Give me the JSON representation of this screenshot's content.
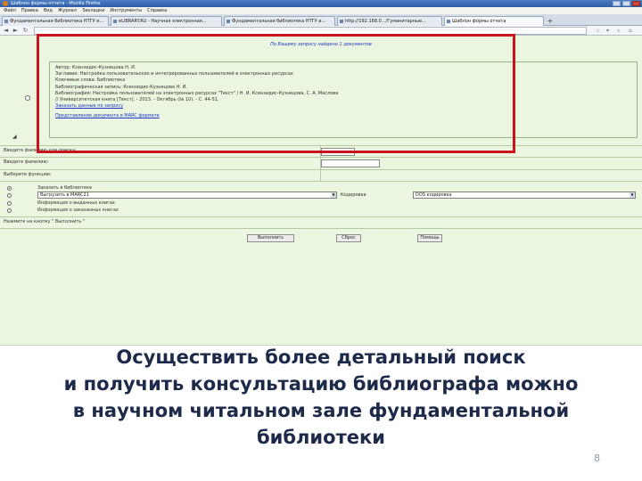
{
  "window": {
    "title": "Шаблон формы отчета - Mozilla Firefox",
    "controls": [
      "minimize",
      "maximize",
      "close"
    ]
  },
  "menu": [
    "Файл",
    "Правка",
    "Вид",
    "Журнал",
    "Закладки",
    "Инструменты",
    "Справка"
  ],
  "tabs": [
    {
      "label": "Фундаментальная библиотека НТГУ и...",
      "active": false
    },
    {
      "label": "eLIBRARY.RU - Научная электронная...",
      "active": false
    },
    {
      "label": "Фундаментальная библиотека НТГУ и...",
      "active": false
    },
    {
      "label": "http://192.168.0.../Гуманитарные...",
      "active": false
    },
    {
      "label": "Шаблон формы отчета",
      "active": true
    }
  ],
  "nav": {
    "back_icon": "back-icon",
    "forward_icon": "forward-icon",
    "home_icon": "home-icon",
    "url": ""
  },
  "results": {
    "found_message": "По Вашему запросу найдено 1 документов",
    "record_lines": [
      "Автор: Ксензидис-Кузнецова Н. И.",
      "Заглавие: Настройка пользовательских и интегрированных пользователей в электронных ресурсах",
      "Ключевые слова: Библиотека",
      "Библиографическая запись: Ксензидис-Кузнецова Н. И.",
      "Библиография: Настройка пользователей на электронных ресурсах \"Текст\" / Н. И. Ксензидис-Кузнецова, С. А. Маслова",
      "// Университетская книга [Текст]. - 2013. - Октябрь (№ 10). - С. 44-51."
    ],
    "link_order": "Заказать данные по запросу",
    "link_marc": "Представление документа в MARC формате"
  },
  "form": {
    "label_1": "Введите фамилию для поиска:",
    "label_2": "Введите фамилию:",
    "label_3": "Выберите функцию:",
    "functions": [
      {
        "label": "Заказать в библиотеке",
        "selected": true
      },
      {
        "label": "Выгрузить в MARC21",
        "selected": false
      },
      {
        "label": "Информация о выданных книгах",
        "selected": false
      },
      {
        "label": "Информация о заказанных книгах",
        "selected": false
      }
    ],
    "select_format": "Выгрузить в MARC21",
    "select_encoding_label": "Кодировка",
    "select_encoding": "DOS кодировка",
    "footer_label": "Нажмите на кнопку \" Выполнить \"",
    "btn_run": "Выполнить",
    "btn_reset": "Сброс",
    "btn_help": "Помощь"
  },
  "caption_lines": [
    "Осуществить более детальный поиск",
    "и получить консультацию библиографа можно",
    "в научном читальном зале фундаментальной",
    "библиотеки"
  ],
  "page_number": "8",
  "colors": {
    "highlight": "#c8141c",
    "page_bg": "#eaf6df",
    "link": "#1d35c8",
    "caption": "#1e2a4a"
  }
}
